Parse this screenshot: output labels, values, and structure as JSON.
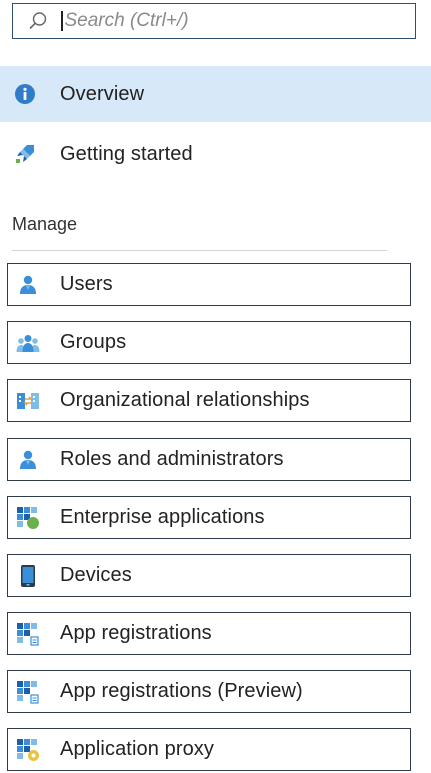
{
  "search": {
    "placeholder": "Search (Ctrl+/)",
    "icon": "search-icon"
  },
  "nav": [
    {
      "id": "overview",
      "label": "Overview",
      "icon": "info-icon",
      "active": true
    },
    {
      "id": "getting-started",
      "label": "Getting started",
      "icon": "rocket-icon",
      "active": false
    }
  ],
  "manage": {
    "header": "Manage",
    "items": [
      {
        "id": "users",
        "label": "Users",
        "icon": "user-icon"
      },
      {
        "id": "groups",
        "label": "Groups",
        "icon": "group-icon"
      },
      {
        "id": "org-relationships",
        "label": "Organizational relationships",
        "icon": "org-relationships-icon"
      },
      {
        "id": "roles",
        "label": "Roles and administrators",
        "icon": "roles-icon"
      },
      {
        "id": "enterprise-apps",
        "label": "Enterprise applications",
        "icon": "enterprise-apps-icon"
      },
      {
        "id": "devices",
        "label": "Devices",
        "icon": "device-icon"
      },
      {
        "id": "app-registrations",
        "label": "App registrations",
        "icon": "app-registrations-icon"
      },
      {
        "id": "app-registrations-preview",
        "label": "App registrations (Preview)",
        "icon": "app-registrations-preview-icon"
      },
      {
        "id": "app-proxy",
        "label": "Application proxy",
        "icon": "app-proxy-icon"
      }
    ]
  },
  "colors": {
    "active_bg": "#d7e8f8",
    "icon_blue": "#3a8fd8",
    "icon_light_blue": "#7fbde8",
    "icon_dark_blue": "#1f5fa8",
    "icon_green": "#6ab04c"
  }
}
